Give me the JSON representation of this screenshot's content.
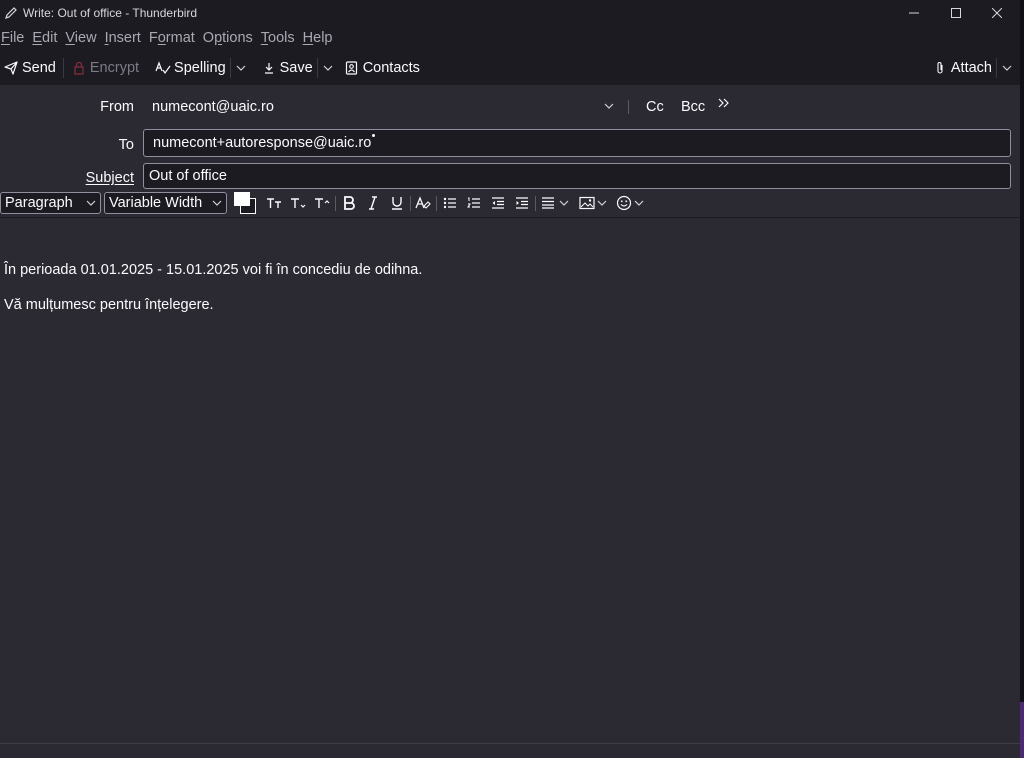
{
  "window": {
    "title": "Write: Out of office - Thunderbird"
  },
  "menubar": {
    "items": [
      {
        "label": "File",
        "key": "F",
        "rest": "ile"
      },
      {
        "label": "Edit",
        "key": "E",
        "rest": "dit"
      },
      {
        "label": "View",
        "key": "V",
        "rest": "iew"
      },
      {
        "label": "Insert",
        "key": "I",
        "rest": "nsert"
      },
      {
        "label": "Format",
        "key": "o",
        "pre": "F",
        "rest": "rmat"
      },
      {
        "label": "Options",
        "key": "p",
        "pre": "O",
        "rest": "tions"
      },
      {
        "label": "Tools",
        "key": "T",
        "rest": "ools"
      },
      {
        "label": "Help",
        "key": "H",
        "rest": "elp"
      }
    ]
  },
  "toolbar": {
    "send": "Send",
    "encrypt": "Encrypt",
    "spelling": "Spelling",
    "save": "Save",
    "contacts": "Contacts",
    "attach": "Attach"
  },
  "headers": {
    "from_label": "From",
    "from_value": "numecont@uaic.ro",
    "cc": "Cc",
    "bcc": "Bcc",
    "to_label": "To",
    "to_recipient": "numecont+autoresponse@uaic.ro",
    "subject_label": "Subject",
    "subject_value": "Out of office"
  },
  "format": {
    "paragraph": "Paragraph",
    "font": "Variable Width"
  },
  "body": {
    "line1": "În perioada 01.01.2025 - 15.01.2025 voi fi în concediu de odihna.",
    "line2": "Vă mulțumesc pentru înțelegere."
  }
}
